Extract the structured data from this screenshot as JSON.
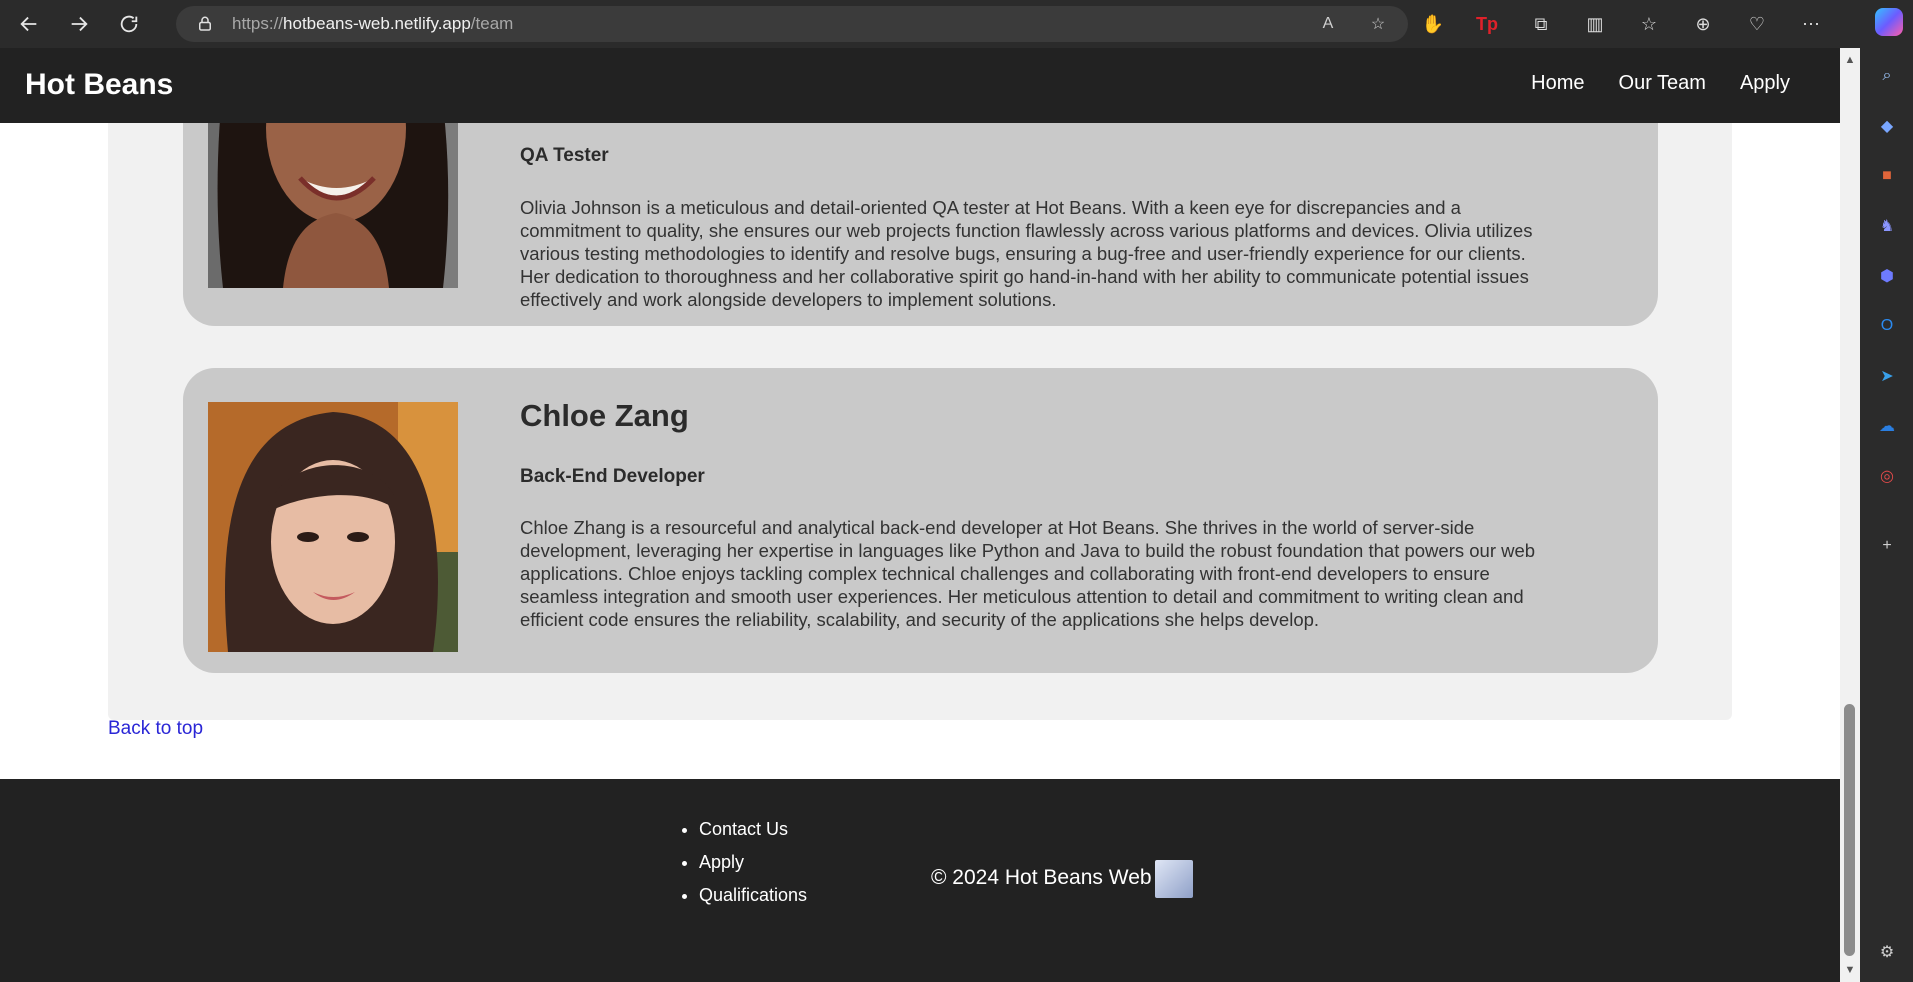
{
  "browser": {
    "url_scheme": "https://",
    "url_host": "hotbeans-web.netlify.app",
    "url_path": "/team"
  },
  "header": {
    "brand": "Hot Beans",
    "nav": [
      "Home",
      "Our Team",
      "Apply"
    ]
  },
  "team": [
    {
      "role": "QA Tester",
      "bio": "Olivia Johnson is a meticulous and detail-oriented QA tester at Hot Beans. With a keen eye for discrepancies and a commitment to quality, she ensures our web projects function flawlessly across various platforms and devices. Olivia utilizes various testing methodologies to identify and resolve bugs, ensuring a bug-free and user-friendly experience for our clients. Her dedication to thoroughness and her collaborative spirit go hand-in-hand with her ability to communicate potential issues effectively and work alongside developers to implement solutions."
    },
    {
      "name": "Chloe Zang",
      "role": "Back-End Developer",
      "bio": "Chloe Zhang is a resourceful and analytical back-end developer at Hot Beans. She thrives in the world of server-side development, leveraging her expertise in languages like Python and Java to build the robust foundation that powers our web applications. Chloe enjoys tackling complex technical challenges and collaborating with front-end developers to ensure seamless integration and smooth user experiences. Her meticulous attention to detail and commitment to writing clean and efficient code ensures the reliability, scalability, and security of the applications she helps develop."
    }
  ],
  "back_to_top": "Back to top",
  "footer": {
    "links": [
      "Contact Us",
      "Apply",
      "Qualifications"
    ],
    "copyright": "© 2024 Hot Beans Web"
  }
}
